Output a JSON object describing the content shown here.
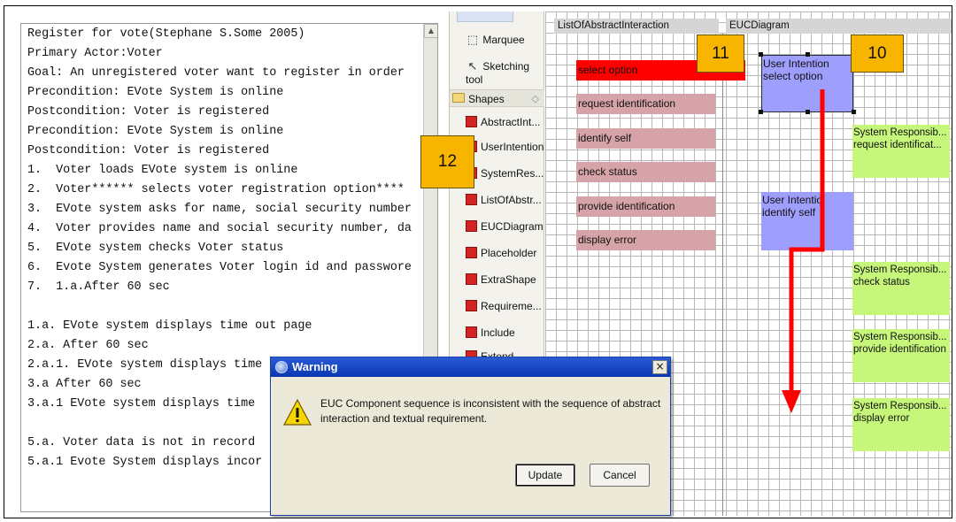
{
  "text_pane": {
    "lines": [
      "Register for vote(Stephane S.Some 2005)",
      "Primary Actor:Voter",
      "Goal: An unregistered voter want to register in order",
      "Precondition: EVote System is online",
      "Postcondition: Voter is registered",
      "Precondition: EVote System is online",
      "Postcondition: Voter is registered",
      "1.  Voter loads EVote system is online",
      "2.  Voter****** selects voter registration option****",
      "3.  EVote system asks for name, social security number",
      "4.  Voter provides name and social security number, da",
      "5.  EVote system checks Voter status",
      "6.  Evote System generates Voter login id and passwore",
      "7.  1.a.After 60 sec",
      "",
      "1.a. EVote system displays time out page",
      "2.a. After 60 sec",
      "2.a.1. EVote system displays time",
      "3.a After 60 sec",
      "3.a.1 EVote system displays time",
      "",
      "5.a. Voter data is not in record",
      "5.a.1 Evote System displays incor"
    ]
  },
  "palette": {
    "tools": [
      {
        "label": "Marquee",
        "icon": "marquee-icon"
      },
      {
        "label": "Sketching tool",
        "icon": "pointer-icon"
      }
    ],
    "drawer_label": "Shapes",
    "shapes": [
      "AbstractInt...",
      "UserIntention",
      "SystemRes...",
      "ListOfAbstr...",
      "EUCDiagram",
      "Placeholder",
      "ExtraShape",
      "Requireme...",
      "Include",
      "Extend"
    ]
  },
  "diagram": {
    "lane_left": "ListOfAbstractInteraction",
    "lane_right": "EUCDiagram",
    "abstract_interactions": [
      "select option",
      "request identification",
      "identify self",
      "check status",
      "provide identification",
      "display error"
    ],
    "user_intentions": [
      {
        "title": "User Intention",
        "text": "select option"
      },
      {
        "title": "User Intentio",
        "text": "identify self"
      }
    ],
    "system_responsibilities": [
      {
        "title": "System Responsib...",
        "text": "request identificat..."
      },
      {
        "title": "System Responsib...",
        "text": "check status"
      },
      {
        "title": "System Responsib...",
        "text": "provide identification"
      },
      {
        "title": "System Responsib...",
        "text": "display error"
      }
    ]
  },
  "callouts": [
    "11",
    "10",
    "12"
  ],
  "dialog": {
    "title": "Warning",
    "message": "EUC Component sequence is inconsistent with the sequence of abstract interaction and textual requirement.",
    "update_label": "Update",
    "cancel_label": "Cancel",
    "close_glyph": "×"
  },
  "colors": {
    "abstract_interaction": "#d6a4a8",
    "user_intention": "#9e9efc",
    "system_responsibility": "#c6f77a",
    "highlight_arrow": "#ff0000",
    "callout": "#f7b500"
  }
}
